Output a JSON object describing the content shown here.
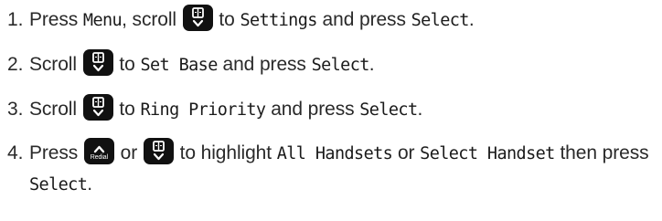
{
  "steps": [
    {
      "number": "1.",
      "t1": "Press ",
      "k1": "Menu",
      "t2": ", scroll ",
      "t3": " to ",
      "k2": "Settings",
      "t4": " and press ",
      "k3": "Select",
      "t5": "."
    },
    {
      "number": "2.",
      "t1": "Scroll ",
      "t2": " to ",
      "k1": "Set Base",
      "t3": " and press ",
      "k2": "Select",
      "t4": "."
    },
    {
      "number": "3.",
      "t1": "Scroll ",
      "t2": " to ",
      "k1": "Ring Priority",
      "t3": " and press ",
      "k2": "Select",
      "t4": "."
    },
    {
      "number": "4.",
      "t1": "Press ",
      "t2": " or ",
      "t3": "  to highlight ",
      "k1": "All Handsets",
      "t4": " or ",
      "k2": "Select Handset",
      "t5": " then press ",
      "k3": "Select",
      "t6": "."
    }
  ],
  "icons": {
    "scroll_key": "phonebook-scroll-down-key-icon",
    "redial_key": "redial-scroll-up-key-icon",
    "redial_label": "Redial",
    "key_color": "#111111"
  }
}
